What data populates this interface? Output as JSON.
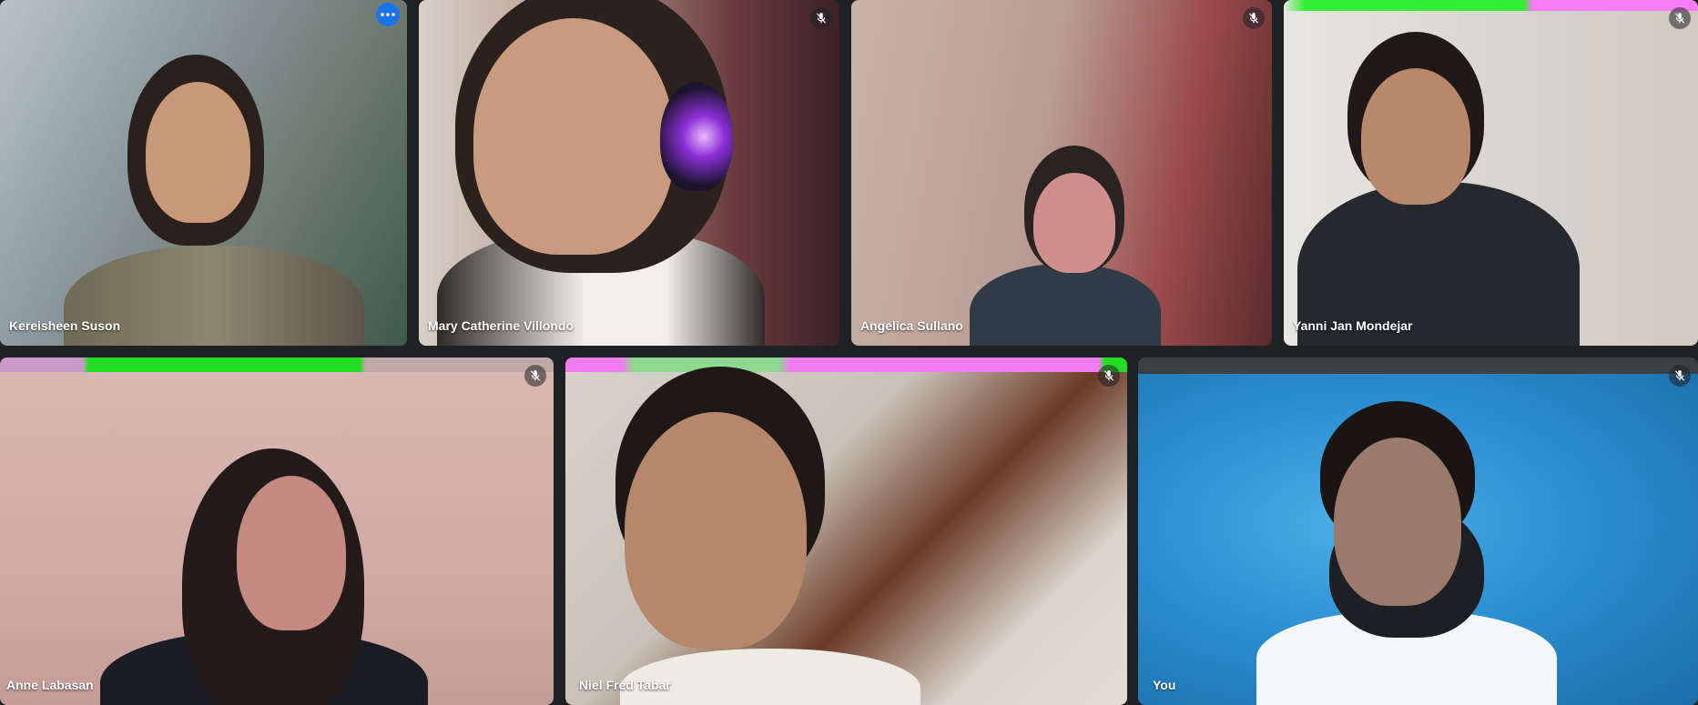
{
  "meeting": {
    "participants": [
      {
        "name": "Kereisheen Suson",
        "muted": false,
        "active_speaker": true
      },
      {
        "name": "Mary Catherine Villondo",
        "muted": true
      },
      {
        "name": "Angelica Sullano",
        "muted": true
      },
      {
        "name": "Yanni Jan Mondejar",
        "muted": true
      },
      {
        "name": "Anne Labasan",
        "muted": true
      },
      {
        "name": "Niel Fred Tabar",
        "muted": true
      },
      {
        "name": "You",
        "muted": true
      }
    ],
    "icons": {
      "more_options": "more-options-icon",
      "mic_off": "mic-off-icon"
    },
    "colors": {
      "background": "#202124",
      "active_border": "#8ab4f8",
      "more_button": "#1a73e8"
    }
  }
}
